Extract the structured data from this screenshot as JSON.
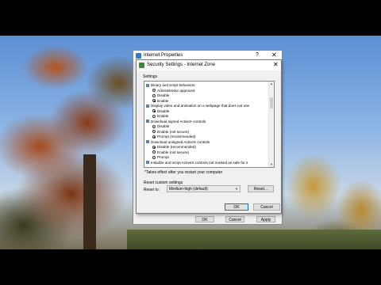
{
  "outer_window": {
    "title": "Internet Properties",
    "help": "?",
    "close": "✕",
    "buttons": {
      "ok": "OK",
      "cancel": "Cancel",
      "apply": "Apply"
    }
  },
  "dialog": {
    "title": "Security Settings - Internet Zone",
    "close": "✕",
    "settings_label": "Settings",
    "rows": [
      {
        "kind": "group",
        "text": "Binary and script behaviors"
      },
      {
        "kind": "option",
        "text": "Administrator approved",
        "checked": false
      },
      {
        "kind": "option",
        "text": "Disable",
        "checked": false
      },
      {
        "kind": "option",
        "text": "Enable",
        "checked": true
      },
      {
        "kind": "group",
        "text": "Display video and animation on a webpage that does not use"
      },
      {
        "kind": "option",
        "text": "Disable",
        "checked": true
      },
      {
        "kind": "option",
        "text": "Enable",
        "checked": false
      },
      {
        "kind": "group",
        "text": "Download signed ActiveX controls"
      },
      {
        "kind": "option",
        "text": "Disable",
        "checked": false
      },
      {
        "kind": "option",
        "text": "Enable (not secure)",
        "checked": false
      },
      {
        "kind": "option",
        "text": "Prompt (recommended)",
        "checked": true
      },
      {
        "kind": "group",
        "text": "Download unsigned ActiveX controls"
      },
      {
        "kind": "option",
        "text": "Disable (recommended)",
        "checked": true
      },
      {
        "kind": "option",
        "text": "Enable (not secure)",
        "checked": false
      },
      {
        "kind": "option",
        "text": "Prompt",
        "checked": false
      },
      {
        "kind": "group",
        "text": "Initialize and script ActiveX controls not marked as safe for s"
      }
    ],
    "note": "*Takes effect after you restart your computer",
    "reset_section_label": "Reset custom settings",
    "reset_to_label": "Reset to:",
    "reset_select_value": "Medium-high (default)",
    "reset_button": "Reset...",
    "ok_button": "OK",
    "cancel_button": "Cancel"
  }
}
